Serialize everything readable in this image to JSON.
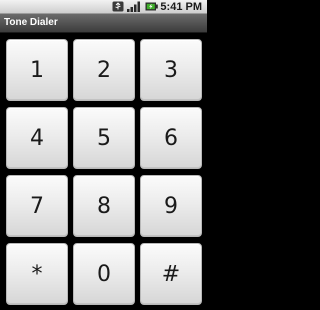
{
  "status_bar": {
    "time": "5:41 PM",
    "icons": [
      "usb-icon",
      "signal-bars-icon",
      "battery-charging-icon"
    ]
  },
  "title_bar": {
    "title": "Tone Dialer"
  },
  "keypad": {
    "keys": [
      "1",
      "2",
      "3",
      "4",
      "5",
      "6",
      "7",
      "8",
      "9",
      "*",
      "0",
      "#"
    ]
  },
  "colors": {
    "background": "#000000",
    "key_face": "#e6e6e6",
    "key_text": "#1a1a1a",
    "title_bar": "#555555",
    "title_text": "#ffffff"
  }
}
